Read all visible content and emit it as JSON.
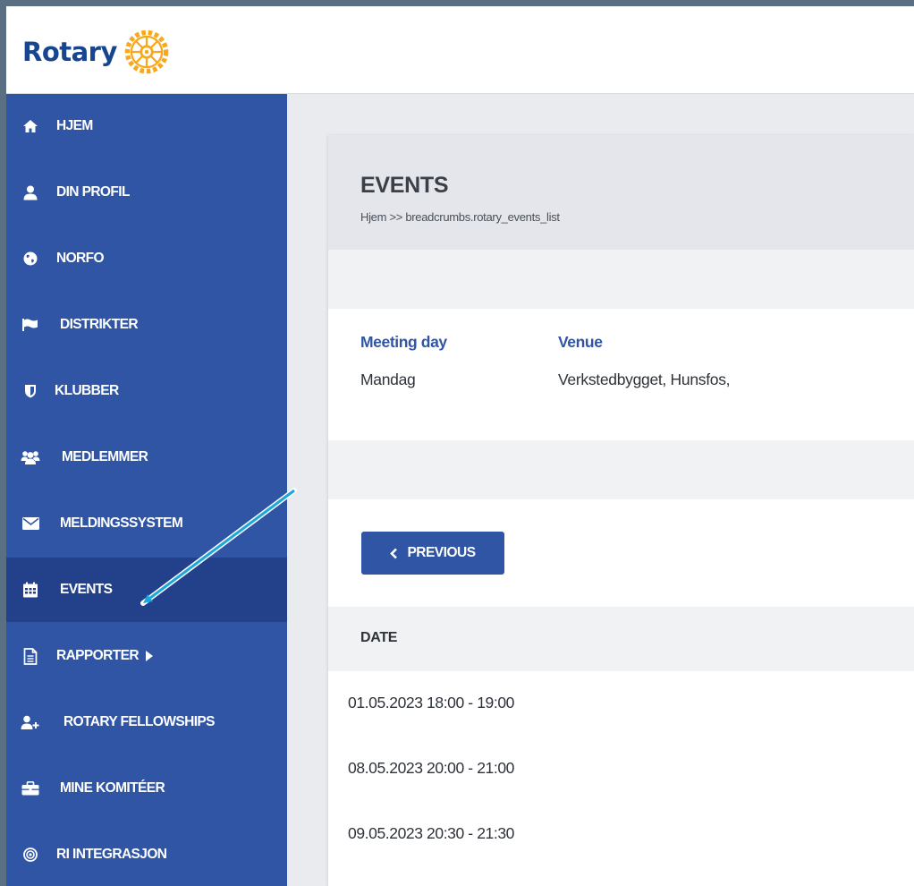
{
  "brand": {
    "name": "Rotary",
    "text_color": "#17458f",
    "wheel_color": "#f7a81b"
  },
  "sidebar": {
    "items": [
      {
        "label": "HJEM",
        "icon": "home-icon"
      },
      {
        "label": "DIN PROFIL",
        "icon": "user-icon"
      },
      {
        "label": "NORFO",
        "icon": "globe-icon"
      },
      {
        "label": "DISTRIKTER",
        "icon": "flag-icon"
      },
      {
        "label": "KLUBBER",
        "icon": "shield-icon"
      },
      {
        "label": "MEDLEMMER",
        "icon": "users-icon"
      },
      {
        "label": "MELDINGSSYSTEM",
        "icon": "envelope-icon"
      },
      {
        "label": "EVENTS",
        "icon": "calendar-icon",
        "active": true
      },
      {
        "label": "RAPPORTER",
        "icon": "document-icon",
        "has_submenu": true
      },
      {
        "label": "ROTARY FELLOWSHIPS",
        "icon": "user-plus-icon"
      },
      {
        "label": "MINE KOMITÉER",
        "icon": "briefcase-icon"
      },
      {
        "label": "RI INTEGRASJON",
        "icon": "target-icon"
      }
    ]
  },
  "page": {
    "title": "EVENTS",
    "breadcrumb": "Hjem >> breadcrumbs.rotary_events_list"
  },
  "meeting_info": {
    "day_label": "Meeting day",
    "day_value": "Mandag",
    "venue_label": "Venue",
    "venue_value": "Verkstedbygget, Hunsfos,"
  },
  "pagination": {
    "previous_label": "PREVIOUS"
  },
  "events_table": {
    "header_date": "DATE",
    "rows": [
      "01.05.2023 18:00 - 19:00",
      "08.05.2023 20:00 - 21:00",
      "09.05.2023 20:30 - 21:30"
    ]
  },
  "colors": {
    "sidebar_bg": "#2f55a4",
    "sidebar_active_bg": "#23408a",
    "accent": "#2f55a4",
    "annotation_arrow": "#1ba6dc"
  }
}
